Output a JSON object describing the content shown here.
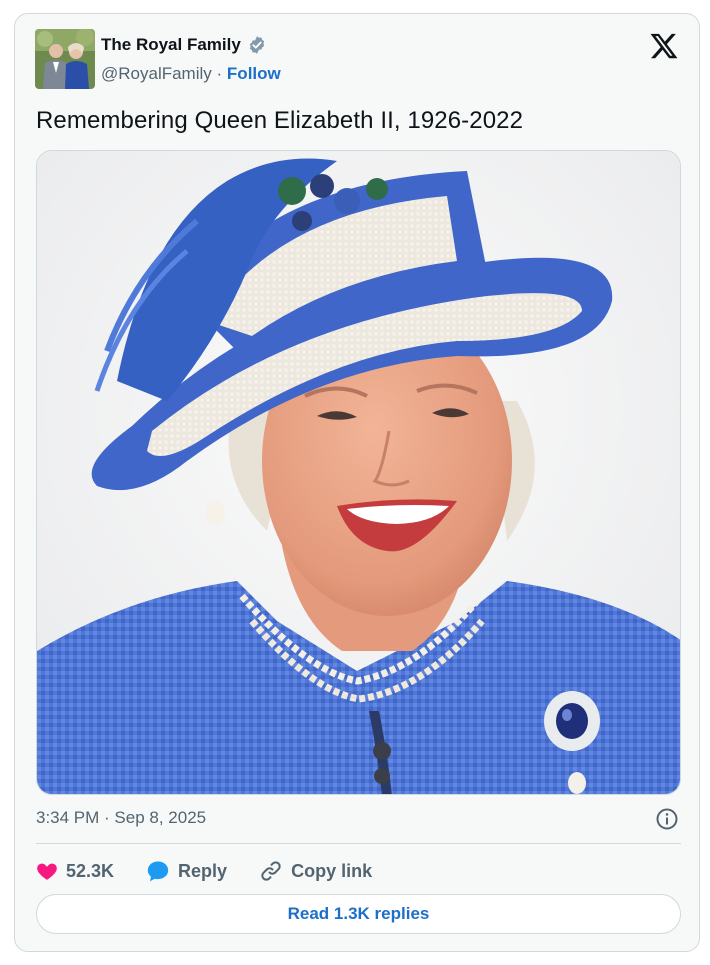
{
  "author": {
    "display_name": "The Royal Family",
    "handle": "@RoyalFamily",
    "separator": "·",
    "follow_label": "Follow",
    "avatar_icon": "royal-couple-avatar",
    "verified_icon": "verified-badge-icon"
  },
  "brand": {
    "logo_icon": "x-logo-icon"
  },
  "tweet": {
    "text": "Remembering Queen Elizabeth II, 1926-2022",
    "image_icon": "portrait-queen-blue-hat"
  },
  "meta": {
    "timestamp": "3:34 PM · Sep 8, 2025",
    "info_icon": "info-icon"
  },
  "actions": {
    "like_count": "52.3K",
    "reply_label": "Reply",
    "copy_link_label": "Copy link"
  },
  "read_replies_label": "Read 1.3K replies",
  "colors": {
    "link_blue": "#1d6fc9",
    "like_pink": "#f91880",
    "reply_blue": "#1d9bf0",
    "muted_text": "#536471",
    "border": "#cfd9de",
    "card_bg": "#f7f9f9",
    "coat_blue": "#4f76d6"
  }
}
